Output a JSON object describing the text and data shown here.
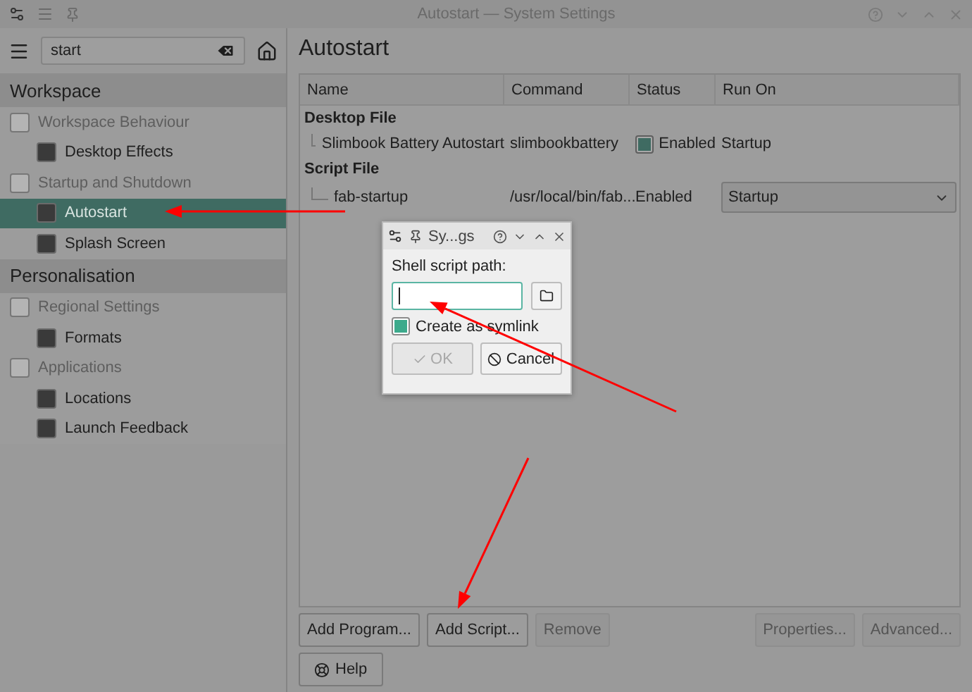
{
  "window": {
    "title": "Autostart — System Settings"
  },
  "sidebar": {
    "search": {
      "value": "start"
    },
    "sections": [
      {
        "title": "Workspace",
        "items": [
          {
            "label": "Workspace Behaviour",
            "kind": "category",
            "selected": false
          },
          {
            "label": "Desktop Effects",
            "kind": "module",
            "selected": false
          },
          {
            "label": "Startup and Shutdown",
            "kind": "category",
            "selected": false
          },
          {
            "label": "Autostart",
            "kind": "module",
            "selected": true
          },
          {
            "label": "Splash Screen",
            "kind": "module",
            "selected": false
          }
        ]
      },
      {
        "title": "Personalisation",
        "items": [
          {
            "label": "Regional Settings",
            "kind": "category",
            "selected": false
          },
          {
            "label": "Formats",
            "kind": "module",
            "selected": false
          },
          {
            "label": "Applications",
            "kind": "category",
            "selected": false
          },
          {
            "label": "Locations",
            "kind": "module",
            "selected": false
          },
          {
            "label": "Launch Feedback",
            "kind": "module",
            "selected": false
          }
        ]
      }
    ]
  },
  "main": {
    "title": "Autostart",
    "table": {
      "columns": [
        "Name",
        "Command",
        "Status",
        "Run On"
      ],
      "groups": [
        {
          "title": "Desktop File",
          "rows": [
            {
              "name": "Slimbook Battery Autostart",
              "command": "slimbookbattery",
              "status": {
                "text": "Enabled",
                "kind": "checkbox",
                "checked": true
              },
              "run_on": {
                "text": "Startup",
                "kind": "text"
              }
            }
          ]
        },
        {
          "title": "Script File",
          "rows": [
            {
              "name": "fab-startup",
              "command": "/usr/local/bin/fab...",
              "status": {
                "text": "Enabled",
                "kind": "text"
              },
              "run_on": {
                "text": "Startup",
                "kind": "dropdown"
              }
            }
          ]
        }
      ]
    },
    "buttons_left": [
      {
        "label": "Add Program...",
        "disabled": false
      },
      {
        "label": "Add Script...",
        "disabled": false
      },
      {
        "label": "Remove",
        "disabled": true
      }
    ],
    "buttons_right": [
      {
        "label": "Properties...",
        "disabled": true
      },
      {
        "label": "Advanced...",
        "disabled": true
      }
    ],
    "help_button": {
      "label": "Help"
    }
  },
  "dialog": {
    "title": "Sy...gs",
    "field_label": "Shell script path:",
    "checkbox": {
      "label": "Create as symlink",
      "checked": true
    },
    "buttons": [
      {
        "label": "OK",
        "kind": "ok",
        "disabled": true
      },
      {
        "label": "Cancel",
        "kind": "cancel",
        "disabled": false
      }
    ]
  }
}
